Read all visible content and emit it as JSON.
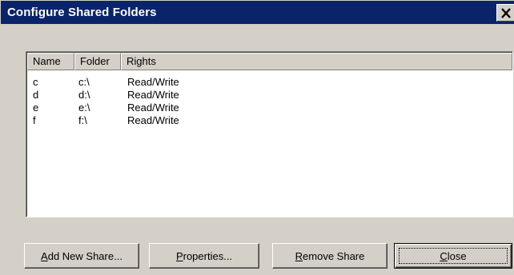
{
  "window": {
    "title": "Configure Shared Folders",
    "close_glyph": "✕"
  },
  "list": {
    "columns": [
      "Name",
      "Folder",
      "Rights"
    ],
    "rows": [
      {
        "name": "c",
        "folder": "c:\\",
        "rights": "Read/Write"
      },
      {
        "name": "d",
        "folder": "d:\\",
        "rights": "Read/Write"
      },
      {
        "name": "e",
        "folder": "e:\\",
        "rights": "Read/Write"
      },
      {
        "name": "f",
        "folder": "f:\\",
        "rights": "Read/Write"
      }
    ]
  },
  "buttons": {
    "add": {
      "mnemonic": "A",
      "rest": "dd New Share..."
    },
    "properties": {
      "mnemonic": "P",
      "rest": "roperties..."
    },
    "remove": {
      "mnemonic": "R",
      "rest": "emove Share"
    },
    "close": {
      "mnemonic": "C",
      "rest": "lose"
    }
  },
  "colors": {
    "titlebar": "#0a246a",
    "face": "#d4d0c8"
  }
}
